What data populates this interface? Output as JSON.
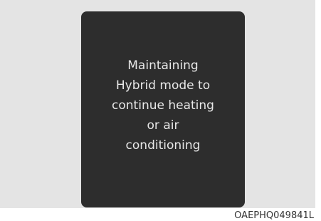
{
  "display": {
    "message_lines": [
      "Maintaining",
      "Hybrid mode to",
      "continue heating",
      "or air",
      "conditioning"
    ]
  },
  "figure_code": "OAEPHQ049841L"
}
